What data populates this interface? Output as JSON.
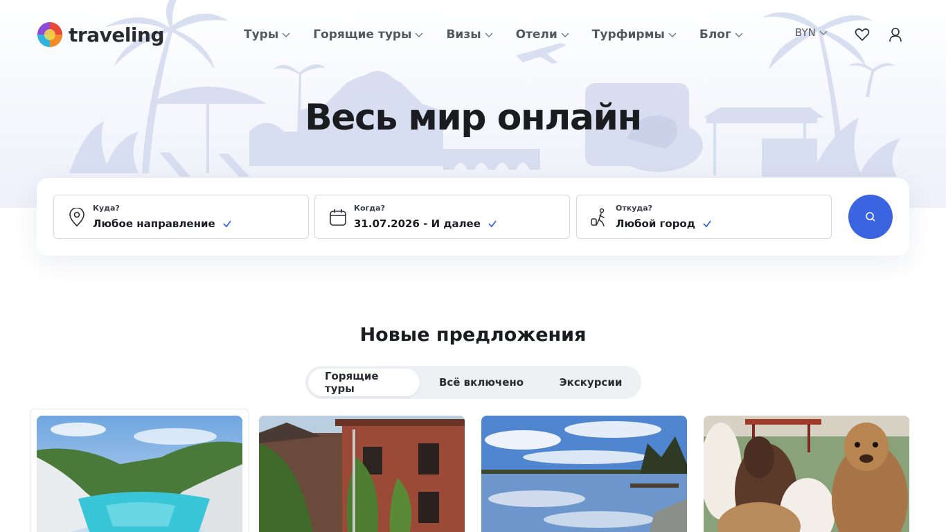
{
  "brand": {
    "name": "traveling"
  },
  "nav": {
    "items": [
      {
        "label": "Туры"
      },
      {
        "label": "Горящие туры"
      },
      {
        "label": "Визы"
      },
      {
        "label": "Отели"
      },
      {
        "label": "Турфирмы"
      },
      {
        "label": "Блог"
      }
    ],
    "currency": "BYN"
  },
  "hero": {
    "title": "Весь мир онлайн"
  },
  "search": {
    "destination": {
      "label": "Куда?",
      "value": "Любое направление"
    },
    "date": {
      "label": "Когда?",
      "value": "31.07.2026 - И далее"
    },
    "origin": {
      "label": "Откуда?",
      "value": "Любой город"
    }
  },
  "offers": {
    "title": "Новые предложения",
    "tabs": [
      {
        "label": "Горящие туры",
        "active": true
      },
      {
        "label": "Всё включено",
        "active": false
      },
      {
        "label": "Экскурсии",
        "active": false
      }
    ],
    "cards": [
      {
        "image": "turquoise-quarry-lake"
      },
      {
        "image": "ivy-covered-brick-manor"
      },
      {
        "image": "river-with-sky-reflection"
      },
      {
        "image": "alpacas"
      }
    ]
  },
  "colors": {
    "accent": "#3a64e0",
    "text": "#1b1c20",
    "nav_text": "#55575f",
    "tab_bg": "#eef0f4",
    "field_border": "#d6d8de"
  }
}
